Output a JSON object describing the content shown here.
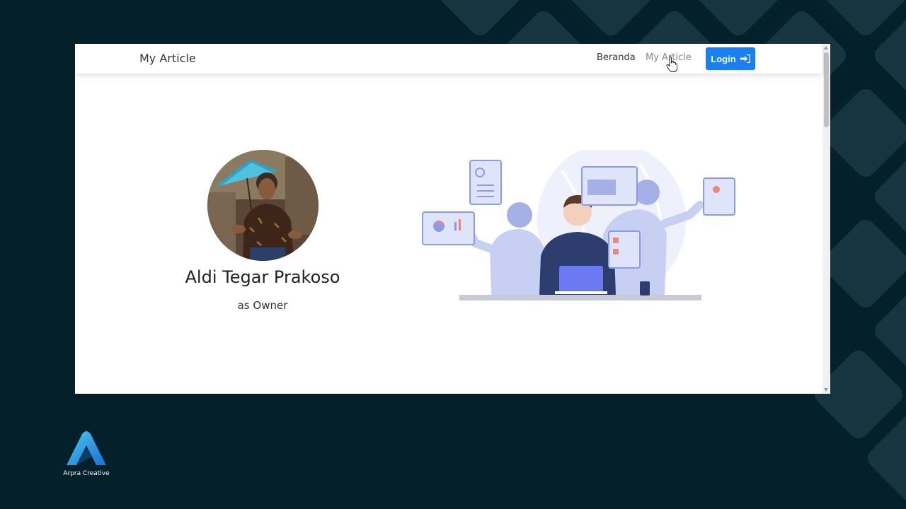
{
  "navbar": {
    "brand": "My Article",
    "links": [
      {
        "label": "Beranda"
      },
      {
        "label": "My Article"
      }
    ],
    "login_label": "Login"
  },
  "profile": {
    "name": "Aldi Tegar Prakoso",
    "role": "as Owner"
  },
  "watermark": {
    "text": "Arpra Creative"
  },
  "colors": {
    "background": "#04202b",
    "pattern": "#173540",
    "accent": "#1a7ff0",
    "illustration": "#8c9be8"
  }
}
